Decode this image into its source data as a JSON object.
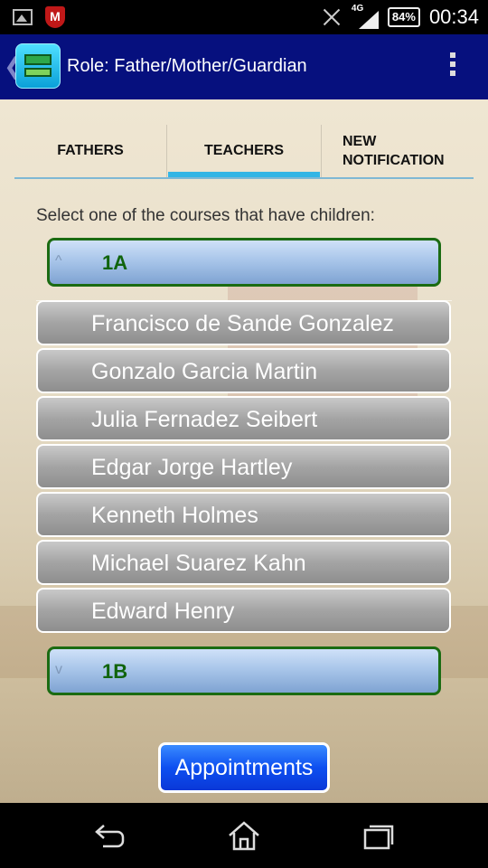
{
  "status_bar": {
    "network": "4G",
    "battery": "84%",
    "time": "00:34"
  },
  "action_bar": {
    "up_glyph": "❮",
    "title": "Role: Father/Mother/Guardian",
    "logo_icon": "app-logo-icon",
    "overflow_icon": "overflow-menu-icon"
  },
  "tabs": [
    {
      "label": "FATHERS",
      "selected": false
    },
    {
      "label": "TEACHERS",
      "selected": true
    },
    {
      "label": "NEW NOTIFICATION",
      "selected": false
    }
  ],
  "prompt": "Select one of the courses that have children:",
  "courses": [
    {
      "label": "1A",
      "chevron": "^",
      "expanded": true,
      "students": [
        "Francisco de Sande Gonzalez",
        "Gonzalo Garcia Martin",
        "Julia Fernadez Seibert",
        "Edgar Jorge Hartley",
        "Kenneth Holmes",
        "Michael Suarez Kahn",
        "Edward Henry"
      ]
    },
    {
      "label": "1B",
      "chevron": "v",
      "expanded": false
    }
  ],
  "appointments_label": "Appointments",
  "colors": {
    "action_bar": "#06107e",
    "tab_indicator": "#33b5e5",
    "course_header_border": "#1b6b12",
    "course_label": "#10640c",
    "appointments_button": "#0d4ff0"
  }
}
